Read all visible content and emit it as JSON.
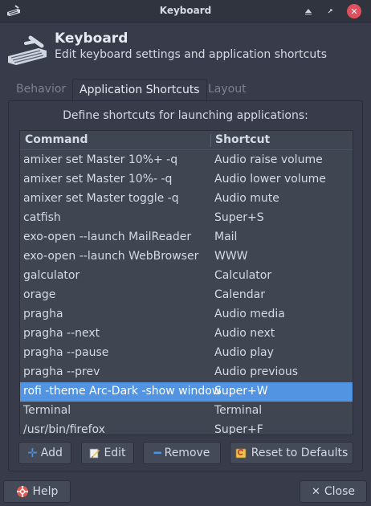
{
  "window": {
    "title": "Keyboard"
  },
  "header": {
    "title": "Keyboard",
    "subtitle": "Edit keyboard settings and application shortcuts"
  },
  "tabs": [
    {
      "label": "Behavior",
      "active": false
    },
    {
      "label": "Application Shortcuts",
      "active": true
    },
    {
      "label": "Layout",
      "active": false
    }
  ],
  "panel": {
    "instruction": "Define shortcuts for launching applications:",
    "columns": {
      "command": "Command",
      "shortcut": "Shortcut"
    },
    "rows": [
      {
        "command": "amixer set Master 10%+ -q",
        "shortcut": "Audio raise volume"
      },
      {
        "command": "amixer set Master 10%- -q",
        "shortcut": "Audio lower volume"
      },
      {
        "command": "amixer set Master toggle -q",
        "shortcut": "Audio mute"
      },
      {
        "command": "catfish",
        "shortcut": "Super+S"
      },
      {
        "command": "exo-open --launch MailReader",
        "shortcut": "Mail"
      },
      {
        "command": "exo-open --launch WebBrowser",
        "shortcut": "WWW"
      },
      {
        "command": "galculator",
        "shortcut": "Calculator"
      },
      {
        "command": "orage",
        "shortcut": "Calendar"
      },
      {
        "command": "pragha",
        "shortcut": "Audio media"
      },
      {
        "command": "pragha --next",
        "shortcut": "Audio next"
      },
      {
        "command": "pragha --pause",
        "shortcut": "Audio play"
      },
      {
        "command": "pragha --prev",
        "shortcut": "Audio previous"
      },
      {
        "command": "rofi -theme Arc-Dark -show window",
        "shortcut": "Super+W"
      },
      {
        "command": "Terminal",
        "shortcut": "Terminal"
      },
      {
        "command": "/usr/bin/firefox",
        "shortcut": "Super+F"
      }
    ],
    "selected_row": 12,
    "buttons": {
      "add": "Add",
      "edit": "Edit",
      "remove": "Remove",
      "reset": "Reset to Defaults"
    }
  },
  "footer": {
    "help": "Help",
    "close": "Close"
  },
  "colors": {
    "background": "#383c4a",
    "selection": "#5294e2",
    "close_button": "#e04f5c"
  },
  "icons": {
    "app": "keyboard-icon",
    "header": "keyboard-icon",
    "add": "plus-icon",
    "edit": "pencil-icon",
    "remove": "minus-icon",
    "reset": "reset-icon",
    "help": "help-icon",
    "close": "close-icon"
  }
}
